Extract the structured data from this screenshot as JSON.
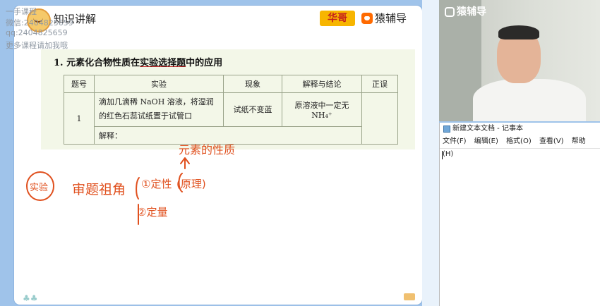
{
  "board": {
    "section_title": "知识讲解",
    "brand_teacher": "华哥",
    "brand_name": "猿辅导"
  },
  "overlay": {
    "line1": "一手课程",
    "line2": "微信:2404825659",
    "line3": "qq:2404825659",
    "line4": "更多课程请加我哦"
  },
  "question": {
    "title_prefix": "1. 元素化合物性质在",
    "title_underlined": "实验选择题",
    "title_suffix": "中的应用",
    "headers": [
      "题号",
      "实验",
      "现象",
      "解释与结论",
      "正误"
    ],
    "row": {
      "num": "1",
      "experiment": "滴加几滴稀 NaOH 溶液，将湿润的红色石蕊试纸置于试管口",
      "phenomenon": "试纸不变蓝",
      "conclusion": "原溶液中一定无 NH₄⁺",
      "verdict": ""
    },
    "explain_label": "解释："
  },
  "handwriting": {
    "note_top": "元素的性质",
    "circle": "实验",
    "main": "审题祖角",
    "item1": "①定性",
    "item1b": "(原理)",
    "item2": "②定量"
  },
  "video": {
    "logo": "猿辅导"
  },
  "notepad": {
    "title": "新建文本文档 - 记事本",
    "menu": [
      "文件(F)",
      "编辑(E)",
      "格式(O)",
      "查看(V)",
      "帮助(H)"
    ]
  },
  "colors": {
    "ink": "#e0501e",
    "brand_orange": "#ff6a00",
    "brand_yellow": "#f7b500"
  }
}
